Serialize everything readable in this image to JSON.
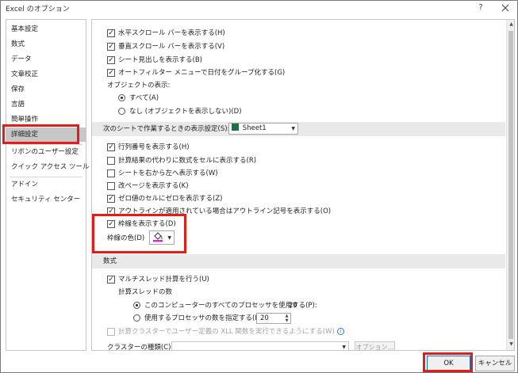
{
  "window": {
    "title": "Excel のオプション",
    "help": "?",
    "close": "✕"
  },
  "sidebar": {
    "items": [
      {
        "label": "基本設定"
      },
      {
        "label": "数式"
      },
      {
        "label": "データ"
      },
      {
        "label": "文章校正"
      },
      {
        "label": "保存"
      },
      {
        "label": "言語"
      },
      {
        "label": "簡単操作"
      },
      {
        "label": "詳細設定",
        "selected": true
      },
      {
        "label": "リボンのユーザー設定"
      },
      {
        "label": "クイック アクセス ツール バー"
      },
      {
        "label": "アドイン"
      },
      {
        "label": "セキュリティ センター"
      }
    ]
  },
  "workbook_display": {
    "options": [
      {
        "label": "水平スクロール バーを表示する(H)",
        "checked": true
      },
      {
        "label": "垂直スクロール バーを表示する(V)",
        "checked": true
      },
      {
        "label": "シート見出しを表示する(B)",
        "checked": true
      },
      {
        "label": "オートフィルター メニューで日付をグループ化する(G)",
        "checked": true
      }
    ],
    "objects_label": "オブジェクトの表示:",
    "objects_options": [
      {
        "label": "すべて(A)",
        "selected": true
      },
      {
        "label": "なし (オブジェクトを表示しない)(D)",
        "selected": false
      }
    ]
  },
  "sheet_display": {
    "header": "次のシートで作業するときの表示設定(S):",
    "sheet_select": "Sheet1",
    "options": [
      {
        "label": "行列番号を表示する(H)",
        "checked": true
      },
      {
        "label": "計算結果の代わりに数式をセルに表示する(R)",
        "checked": false
      },
      {
        "label": "シートを右から左へ表示する(W)",
        "checked": false
      },
      {
        "label": "改ページを表示する(K)",
        "checked": false
      },
      {
        "label": "ゼロ値のセルにゼロを表示する(Z)",
        "checked": true
      },
      {
        "label": "アウトラインが適用されている場合はアウトライン記号を表示する(O)",
        "checked": true
      },
      {
        "label": "枠線を表示する(D)",
        "checked": true
      }
    ],
    "gridline_color_label": "枠線の色(D)",
    "gridline_color": "#cc33cc"
  },
  "formulas": {
    "header": "数式",
    "multithread": {
      "label": "マルチスレッド計算を行う(U)",
      "checked": true
    },
    "threads_label": "計算スレッドの数",
    "threads_options": [
      {
        "label": "このコンピューターのすべてのプロセッサを使用する(P):",
        "value": "20",
        "selected": true
      },
      {
        "label": "使用するプロセッサの数を指定する(M):",
        "value": "20",
        "selected": false
      }
    ],
    "cluster_option": {
      "label": "計算クラスターでユーザー定義の XLL 関数を実行できるようにする(W)",
      "checked": false
    },
    "cluster_type_label": "クラスターの種類(C):",
    "cluster_type_value": "",
    "options_button": "オプション..."
  },
  "footer": {
    "ok": "OK",
    "cancel": "キャンセル"
  },
  "colors": {
    "highlight": "#e21b1b",
    "selected_side": "#c7c7c7"
  }
}
